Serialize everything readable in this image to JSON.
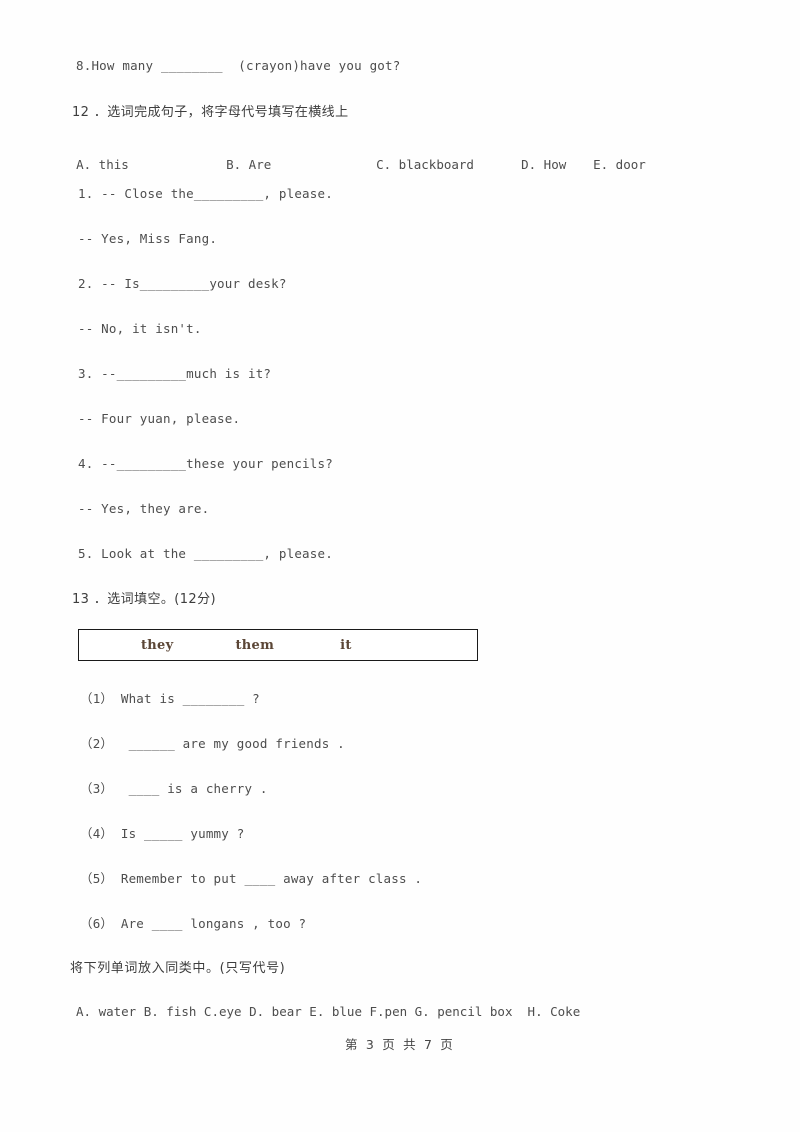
{
  "document": {
    "kind": "english-worksheet-scan",
    "page_footer": "第 3 页 共 7 页"
  },
  "carryover_item": {
    "text": "8.How many ________  (crayon)have you got?"
  },
  "question_12": {
    "heading": "12 ．选词完成句子，将字母代号填写在横线上",
    "options": [
      {
        "label": "A. this"
      },
      {
        "label": "B. Are"
      },
      {
        "label": "C. blackboard"
      },
      {
        "label": "D. How"
      },
      {
        "label": "E. door"
      }
    ],
    "items": [
      {
        "text": "1. -- Close the_________, please."
      },
      {
        "text": "-- Yes, Miss Fang."
      },
      {
        "text": "2. -- Is_________your desk?"
      },
      {
        "text": "-- No, it isn't."
      },
      {
        "text": "3. --_________much is it?"
      },
      {
        "text": "-- Four yuan, please."
      },
      {
        "text": "4. --_________these your pencils?"
      },
      {
        "text": "-- Yes, they are."
      },
      {
        "text": "5. Look at the _________, please."
      }
    ]
  },
  "question_13": {
    "heading": "13 ．选词填空。(12分)",
    "word_bank": [
      "they",
      "them",
      "it"
    ],
    "word_bank_color": "#5b4636",
    "items": [
      {
        "text": "（1） What is ________ ?"
      },
      {
        "text": "（2）  ______ are my good friends ."
      },
      {
        "text": "（3）  ____ is a cherry ."
      },
      {
        "text": "（4） Is _____ yummy ?"
      },
      {
        "text": "（5） Remember to put ____ away after class ."
      },
      {
        "text": "（6） Are ____ longans , too ?"
      }
    ]
  },
  "question_14": {
    "heading": "将下列单词放入同类中。(只写代号)",
    "word_list": "A. water B. fish C.eye D. bear E. blue F.pen G. pencil box  H. Coke"
  }
}
